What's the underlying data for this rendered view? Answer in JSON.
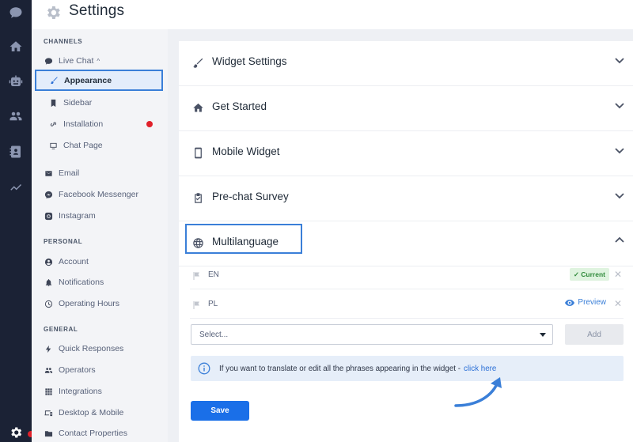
{
  "header": {
    "title": "Settings"
  },
  "menu": {
    "sections": {
      "channels": "CHANNELS",
      "personal": "PERSONAL",
      "general": "GENERAL"
    },
    "items": {
      "live_chat": "Live Chat",
      "appearance": "Appearance",
      "sidebar": "Sidebar",
      "installation": "Installation",
      "chat_page": "Chat Page",
      "email": "Email",
      "facebook": "Facebook Messenger",
      "instagram": "Instagram",
      "account": "Account",
      "notifications": "Notifications",
      "operating_hours": "Operating Hours",
      "quick_responses": "Quick Responses",
      "operators": "Operators",
      "integrations": "Integrations",
      "desktop_mobile": "Desktop & Mobile",
      "contact_properties": "Contact Properties"
    }
  },
  "panels": {
    "widget_settings": "Widget Settings",
    "get_started": "Get Started",
    "mobile_widget": "Mobile Widget",
    "pre_chat_survey": "Pre-chat Survey",
    "multilanguage": "Multilanguage"
  },
  "languages": [
    {
      "code": "EN",
      "status": "Current"
    },
    {
      "code": "PL",
      "status": "Preview"
    }
  ],
  "language_select": {
    "placeholder": "Select...",
    "add_label": "Add"
  },
  "info": {
    "text": "If you want to translate or edit all the phrases appearing in the widget -",
    "link": "click here"
  },
  "save_label": "Save",
  "colors": {
    "accent": "#1a6fe8",
    "rail": "#1b2235",
    "alert": "#e0202a",
    "current_badge": "#2f8a3a"
  }
}
